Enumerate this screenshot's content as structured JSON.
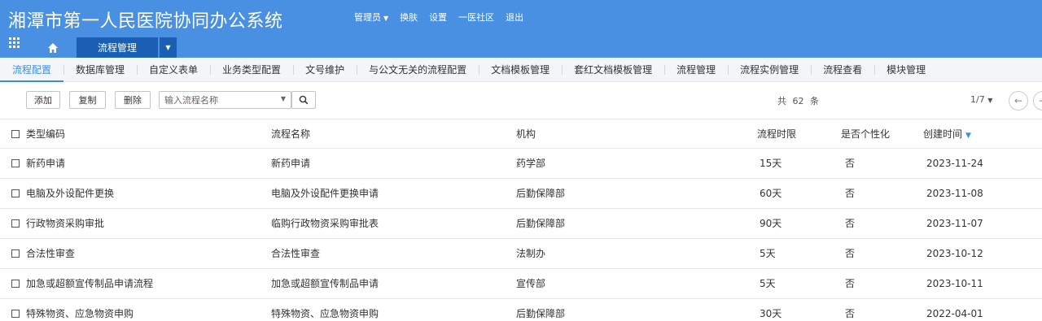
{
  "header": {
    "title": "湘潭市第一人民医院协同办公系统",
    "nav": [
      {
        "label": "管理员",
        "has_caret": true
      },
      {
        "label": "换肤"
      },
      {
        "label": "设置"
      },
      {
        "label": "一医社区"
      },
      {
        "label": "退出"
      }
    ],
    "active_tab": "流程管理",
    "accent_color": "#4a90e2"
  },
  "subnav": {
    "items": [
      "流程配置",
      "数据库管理",
      "自定义表单",
      "业务类型配置",
      "文号维护",
      "与公文无关的流程配置",
      "文档模板管理",
      "套红文档模板管理",
      "流程管理",
      "流程实例管理",
      "流程查看",
      "模块管理"
    ],
    "active_index": 0
  },
  "toolbar": {
    "add_label": "添加",
    "copy_label": "复制",
    "delete_label": "删除",
    "search_placeholder": "输入流程名称",
    "count_text": "共 62 条",
    "pager_text": "1/7"
  },
  "table": {
    "headers": [
      "类型编码",
      "流程名称",
      "机构",
      "流程时限",
      "是否个性化",
      "创建时间"
    ],
    "rows": [
      [
        "新药申请",
        "新药申请",
        "药学部",
        "15天",
        "否",
        "2023-11-24"
      ],
      [
        "电脑及外设配件更换",
        "电脑及外设配件更换申请",
        "后勤保障部",
        "60天",
        "否",
        "2023-11-08"
      ],
      [
        "行政物资采购审批",
        "​临购行政物资采购审批表",
        "后勤保障部",
        "90天",
        "否",
        "2023-11-07"
      ],
      [
        "合法性审查",
        "合法性审查",
        "法制办",
        "5天",
        "否",
        "2023-10-12"
      ],
      [
        "加急或超额宣传制品申请流程",
        "加急或超额宣传制品申请",
        "宣传部",
        "5天",
        "否",
        "2023-10-11"
      ],
      [
        "特殊物资、应急物资申购",
        "特殊物资、应急物资申购",
        "后勤保障部",
        "30天",
        "否",
        "2022-04-01"
      ]
    ]
  }
}
